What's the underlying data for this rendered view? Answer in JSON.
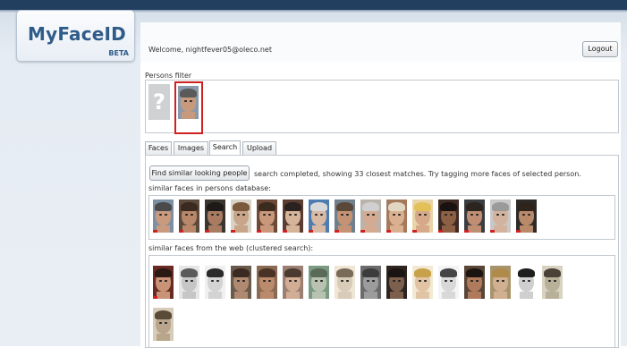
{
  "app": {
    "logo": "MyFaceID",
    "badge": "BETA"
  },
  "header": {
    "welcome": "Welcome,  nightfever05@oleco.net",
    "logout_label": "Logout"
  },
  "persons_filter": {
    "label": "Persons filter",
    "placeholder_glyph": "?"
  },
  "tabs": [
    {
      "label": "Faces"
    },
    {
      "label": "Images"
    },
    {
      "label": "Search",
      "active": true
    },
    {
      "label": "Upload"
    }
  ],
  "search": {
    "button_label": "Find similar looking people",
    "status": "search completed, showing 33 closest matches. Try tagging more faces of selected person.",
    "db_label": "similar faces in persons database:",
    "web_label": "similar faces from the web (clustered search):"
  },
  "colors": {
    "selected_border": "#d0201f",
    "brand": "#2f5b8a"
  },
  "db_faces": [
    {
      "skin": "#c99a7e",
      "hair": "#4a4a4a",
      "bg": "#7d8fa3",
      "mark": "#d0201f"
    },
    {
      "skin": "#b9876a",
      "hair": "#3a2a20",
      "bg": "#5c4a3c",
      "mark": "#d0201f"
    },
    {
      "skin": "#a97c62",
      "hair": "#1e1a18",
      "bg": "#3b3530",
      "mark": "#d0201f"
    },
    {
      "skin": "#c8a589",
      "hair": "#7a5a3a",
      "bg": "#d9d2c6",
      "mark": "#d0201f"
    },
    {
      "skin": "#c9987a",
      "hair": "#3b2a1e",
      "bg": "#6d4a38",
      "mark": "#d0201f"
    },
    {
      "skin": "#d6b49a",
      "hair": "#2a2220",
      "bg": "#5a3d32",
      "mark": "#d0201f"
    },
    {
      "skin": "#d7b9a4",
      "hair": "#d8d8d8",
      "bg": "#4e7bb0",
      "mark": "#d0201f"
    },
    {
      "skin": "#c49376",
      "hair": "#5c4838",
      "bg": "#6f7f8c",
      "mark": "#d0201f"
    },
    {
      "skin": "#d4ab92",
      "hair": "#cfcfcf",
      "bg": "#b9b3ab",
      "mark": "#d0201f"
    },
    {
      "skin": "#d9b190",
      "hair": "#e0d6c2",
      "bg": "#a57a5c",
      "mark": "#d0201f"
    },
    {
      "skin": "#d6a98a",
      "hair": "#e2c05a",
      "bg": "#e9d4a8",
      "mark": "#d0201f"
    },
    {
      "skin": "#8d5f45",
      "hair": "#1a1210",
      "bg": "#3e2c24",
      "mark": "#d0201f"
    },
    {
      "skin": "#bf8e73",
      "hair": "#2c241f",
      "bg": "#3a3c40",
      "mark": "#d0201f"
    },
    {
      "skin": "#d3b39d",
      "hair": "#9a9a9a",
      "bg": "#c8c8c8",
      "mark": "#d0201f"
    },
    {
      "skin": "#b88a6a",
      "hair": "#2e241c",
      "bg": "#2d2a28",
      "mark": "#d0201f"
    }
  ],
  "web_faces": [
    {
      "skin": "#c99378",
      "hair": "#2a1a14",
      "bg": "#6a2a22",
      "mark": "#d0201f"
    },
    {
      "skin": "#c6c6c6",
      "hair": "#5a5a5a",
      "bg": "#e6e6e6",
      "mark": ""
    },
    {
      "skin": "#d3d3d3",
      "hair": "#2a2a2a",
      "bg": "#f0f0f0",
      "mark": ""
    },
    {
      "skin": "#b08a70",
      "hair": "#3a2a22",
      "bg": "#6a5a4c",
      "mark": ""
    },
    {
      "skin": "#bb8a6c",
      "hair": "#4a3326",
      "bg": "#8a6a52",
      "mark": ""
    },
    {
      "skin": "#d2ad95",
      "hair": "#4a3a30",
      "bg": "#9a7f72",
      "mark": ""
    },
    {
      "skin": "#b9c2b0",
      "hair": "#5a6a58",
      "bg": "#7b9a82",
      "mark": ""
    },
    {
      "skin": "#d8cbb8",
      "hair": "#7a6a58",
      "bg": "#efe6d6",
      "mark": ""
    },
    {
      "skin": "#9c9c9c",
      "hair": "#3c3c3c",
      "bg": "#6b6b6b",
      "mark": ""
    },
    {
      "skin": "#7c5f4c",
      "hair": "#1a1412",
      "bg": "#2e2420",
      "mark": ""
    },
    {
      "skin": "#e0c4a4",
      "hair": "#c8a24a",
      "bg": "#f2e8d4",
      "mark": ""
    },
    {
      "skin": "#d8d8d8",
      "hair": "#444444",
      "bg": "#f4f4f4",
      "mark": ""
    },
    {
      "skin": "#b07a5c",
      "hair": "#1c1410",
      "bg": "#5a4638",
      "mark": ""
    },
    {
      "skin": "#d0b090",
      "hair": "#b08a48",
      "bg": "#a8946c",
      "mark": ""
    },
    {
      "skin": "#cfcfcf",
      "hair": "#1e1e1e",
      "bg": "#ffffff",
      "mark": ""
    },
    {
      "skin": "#b9b09a",
      "hair": "#4a4236",
      "bg": "#d8d2c0",
      "mark": ""
    },
    {
      "skin": "#b8a58c",
      "hair": "#5a4a38",
      "bg": "#d6ccb8",
      "mark": ""
    }
  ],
  "filter_face": {
    "skin": "#c79a7e",
    "hair": "#5a5a5a",
    "bg": "#8a9aac",
    "mark": ""
  }
}
